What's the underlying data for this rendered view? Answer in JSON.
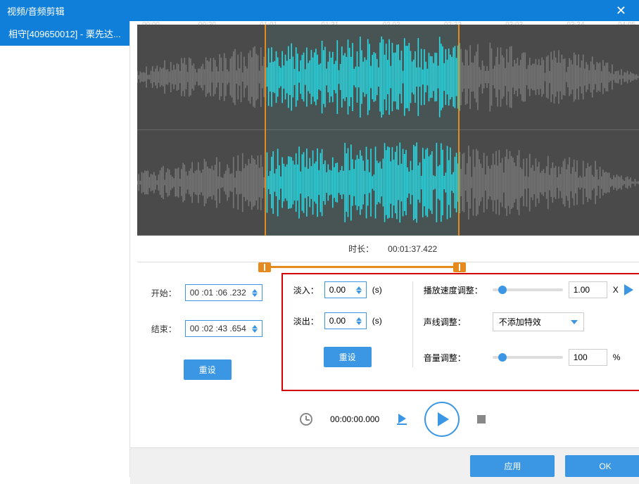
{
  "window": {
    "title": "视频/音频剪辑",
    "close": "✕"
  },
  "sidebar": {
    "item": "相守[409650012] - 栗先达..."
  },
  "timeline": {
    "ticks": [
      "00:00",
      "00:30",
      "01:01",
      "01:31",
      "02:02",
      "02:33",
      "03:03",
      "03:34",
      "04:05"
    ]
  },
  "duration": {
    "label": "时长：",
    "value": "00:01:37.422"
  },
  "selection": {
    "start_pct": 25,
    "end_pct": 63
  },
  "trim": {
    "start_label": "开始：",
    "start_value": "00 :01 :06 .232",
    "end_label": "结束：",
    "end_value": "00 :02 :43 .654",
    "reset": "重设"
  },
  "fade": {
    "in_label": "淡入：",
    "in_value": "0.00",
    "unit": "(s)",
    "out_label": "淡出：",
    "out_value": "0.00",
    "reset": "重设"
  },
  "adjust": {
    "speed_label": "播放速度调整：",
    "speed_value": "1.00",
    "speed_suffix": "X",
    "voice_label": "声线调整：",
    "voice_value": "不添加特效",
    "volume_label": "音量调整：",
    "volume_value": "100",
    "volume_suffix": "%"
  },
  "playback": {
    "time": "00:00:00.000"
  },
  "footer": {
    "apply": "应用",
    "ok": "OK"
  }
}
